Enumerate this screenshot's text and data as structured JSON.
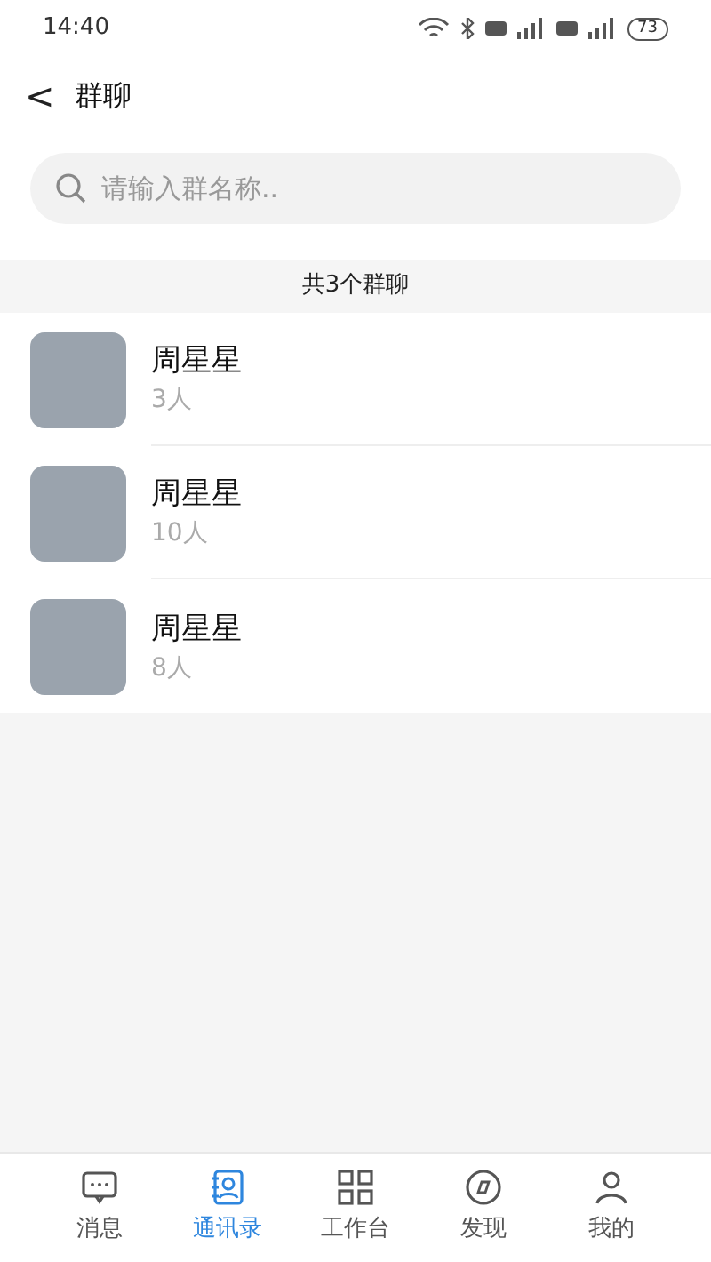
{
  "status_bar": {
    "time": "14:40",
    "battery": "73"
  },
  "header": {
    "back": "<",
    "title": "群聊"
  },
  "search": {
    "placeholder": "请输入群名称.."
  },
  "section": {
    "label": "共3个群聊"
  },
  "groups": [
    {
      "name": "周星星",
      "count": "3人"
    },
    {
      "name": "周星星",
      "count": "10人"
    },
    {
      "name": "周星星",
      "count": "8人"
    }
  ],
  "tabs": [
    {
      "label": "消息",
      "kind": "chat",
      "selected": false
    },
    {
      "label": "通讯录",
      "kind": "contacts",
      "selected": true
    },
    {
      "label": "工作台",
      "kind": "grid",
      "selected": false
    },
    {
      "label": "发现",
      "kind": "discover",
      "selected": false
    },
    {
      "label": "我的",
      "kind": "me",
      "selected": false
    }
  ]
}
